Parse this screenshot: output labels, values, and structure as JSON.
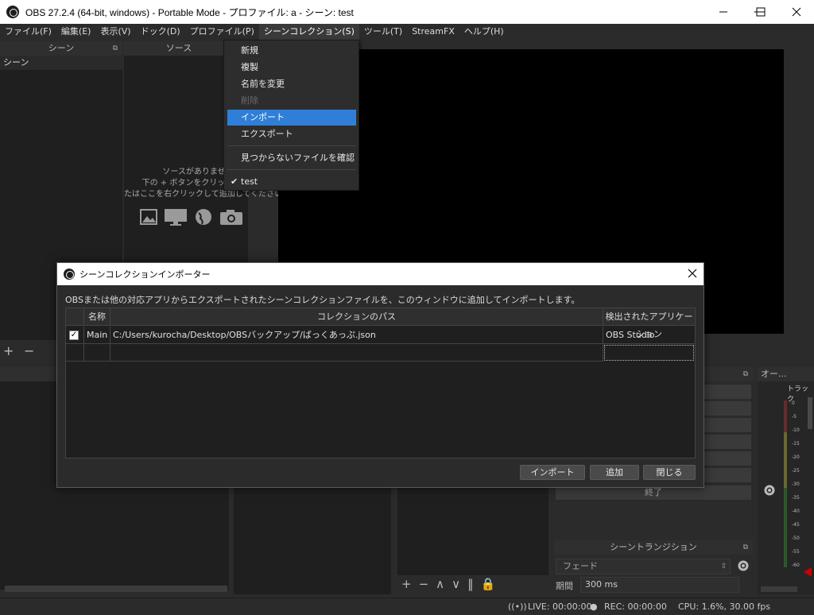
{
  "window": {
    "title": "OBS 27.2.4 (64-bit, windows) - Portable Mode - プロファイル: a - シーン: test",
    "minimize": "—",
    "maximize": "☐",
    "close": "✕"
  },
  "menubar": [
    {
      "label": "ファイル(F)"
    },
    {
      "label": "編集(E)"
    },
    {
      "label": "表示(V)"
    },
    {
      "label": "ドック(D)"
    },
    {
      "label": "プロファイル(P)"
    },
    {
      "label": "シーンコレクション(S)"
    },
    {
      "label": "ツール(T)"
    },
    {
      "label": "StreamFX"
    },
    {
      "label": "ヘルプ(H)"
    }
  ],
  "dropdown": {
    "items": [
      {
        "label": "新規"
      },
      {
        "label": "複製"
      },
      {
        "label": "名前を変更"
      },
      {
        "label": "削除"
      },
      {
        "label": "インポート"
      },
      {
        "label": "エクスポート"
      }
    ],
    "missing_files": "見つからないファイルを確認",
    "collection": "test",
    "check": "✔"
  },
  "scenes_dock": {
    "title": "シーン",
    "item": "シーン"
  },
  "sources_dock": {
    "title": "ソース",
    "empty_line1": "ソースがありません。",
    "empty_line2": "下の + ボタンをクリックす",
    "empty_line3": "たはここを右クリックして追加してください。"
  },
  "dialog": {
    "title": "シーンコレクションインポーター",
    "close": "✕",
    "description": "OBSまたは他の対応アプリからエクスポートされたシーンコレクションファイルを、このウィンドウに追加してインポートします。",
    "columns": {
      "name": "名称",
      "path": "コレクションのパス",
      "app": "検出されたアプリケーション"
    },
    "rows": [
      {
        "checked": "✓",
        "name": "Main",
        "path": "C:/Users/kurocha/Desktop/OBSバックアップ/ばっくあっぷ.json",
        "app": "OBS Studio"
      }
    ],
    "buttons": {
      "import": "インポート",
      "add": "追加",
      "close": "閉じる"
    }
  },
  "controls": {
    "exit": "終了",
    "transition_title": "シーントランジション",
    "transition": "フェード",
    "duration_label": "期間",
    "duration": "300 ms"
  },
  "audio": {
    "title": "オー...",
    "track": "トラック",
    "scale": [
      "0",
      "-5",
      "-10",
      "-15",
      "-20",
      "-25",
      "-30",
      "-35",
      "-40",
      "-45",
      "-50",
      "-55",
      "-60"
    ]
  },
  "statusbar": {
    "live": "LIVE: 00:00:00",
    "rec": "REC: 00:00:00",
    "cpu": "CPU: 1.6%, 30.00 fps"
  }
}
